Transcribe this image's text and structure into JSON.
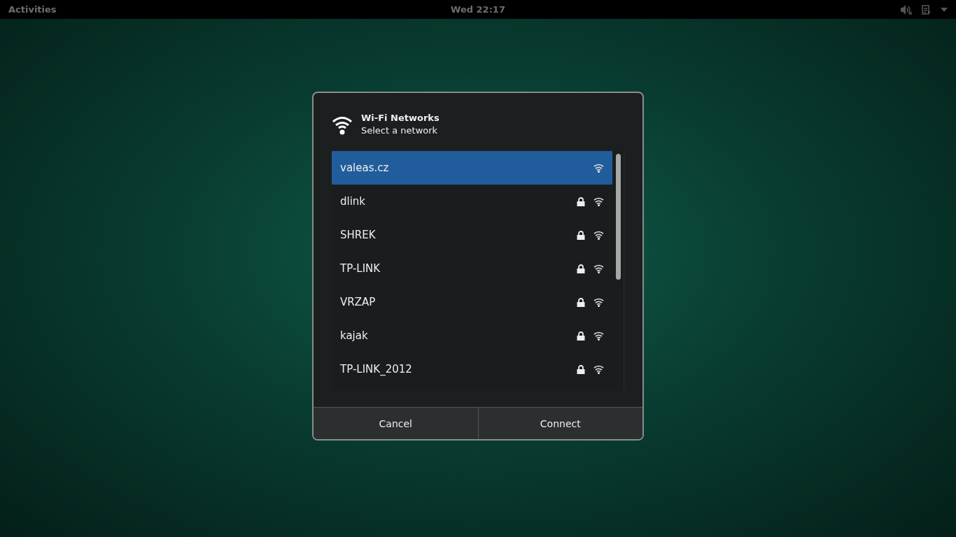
{
  "top_bar": {
    "activities": "Activities",
    "clock": "Wed 22:17"
  },
  "dialog": {
    "title": "Wi-Fi Networks",
    "subtitle": "Select a network",
    "networks": [
      {
        "name": "valeas.cz",
        "selected": true,
        "secured": false
      },
      {
        "name": "dlink",
        "selected": false,
        "secured": true
      },
      {
        "name": "SHREK",
        "selected": false,
        "secured": true
      },
      {
        "name": "TP-LINK",
        "selected": false,
        "secured": true
      },
      {
        "name": "VRZAP",
        "selected": false,
        "secured": true
      },
      {
        "name": "kajak",
        "selected": false,
        "secured": true
      },
      {
        "name": "TP-LINK_2012",
        "selected": false,
        "secured": true
      }
    ],
    "buttons": [
      "Cancel",
      "Connect"
    ]
  }
}
